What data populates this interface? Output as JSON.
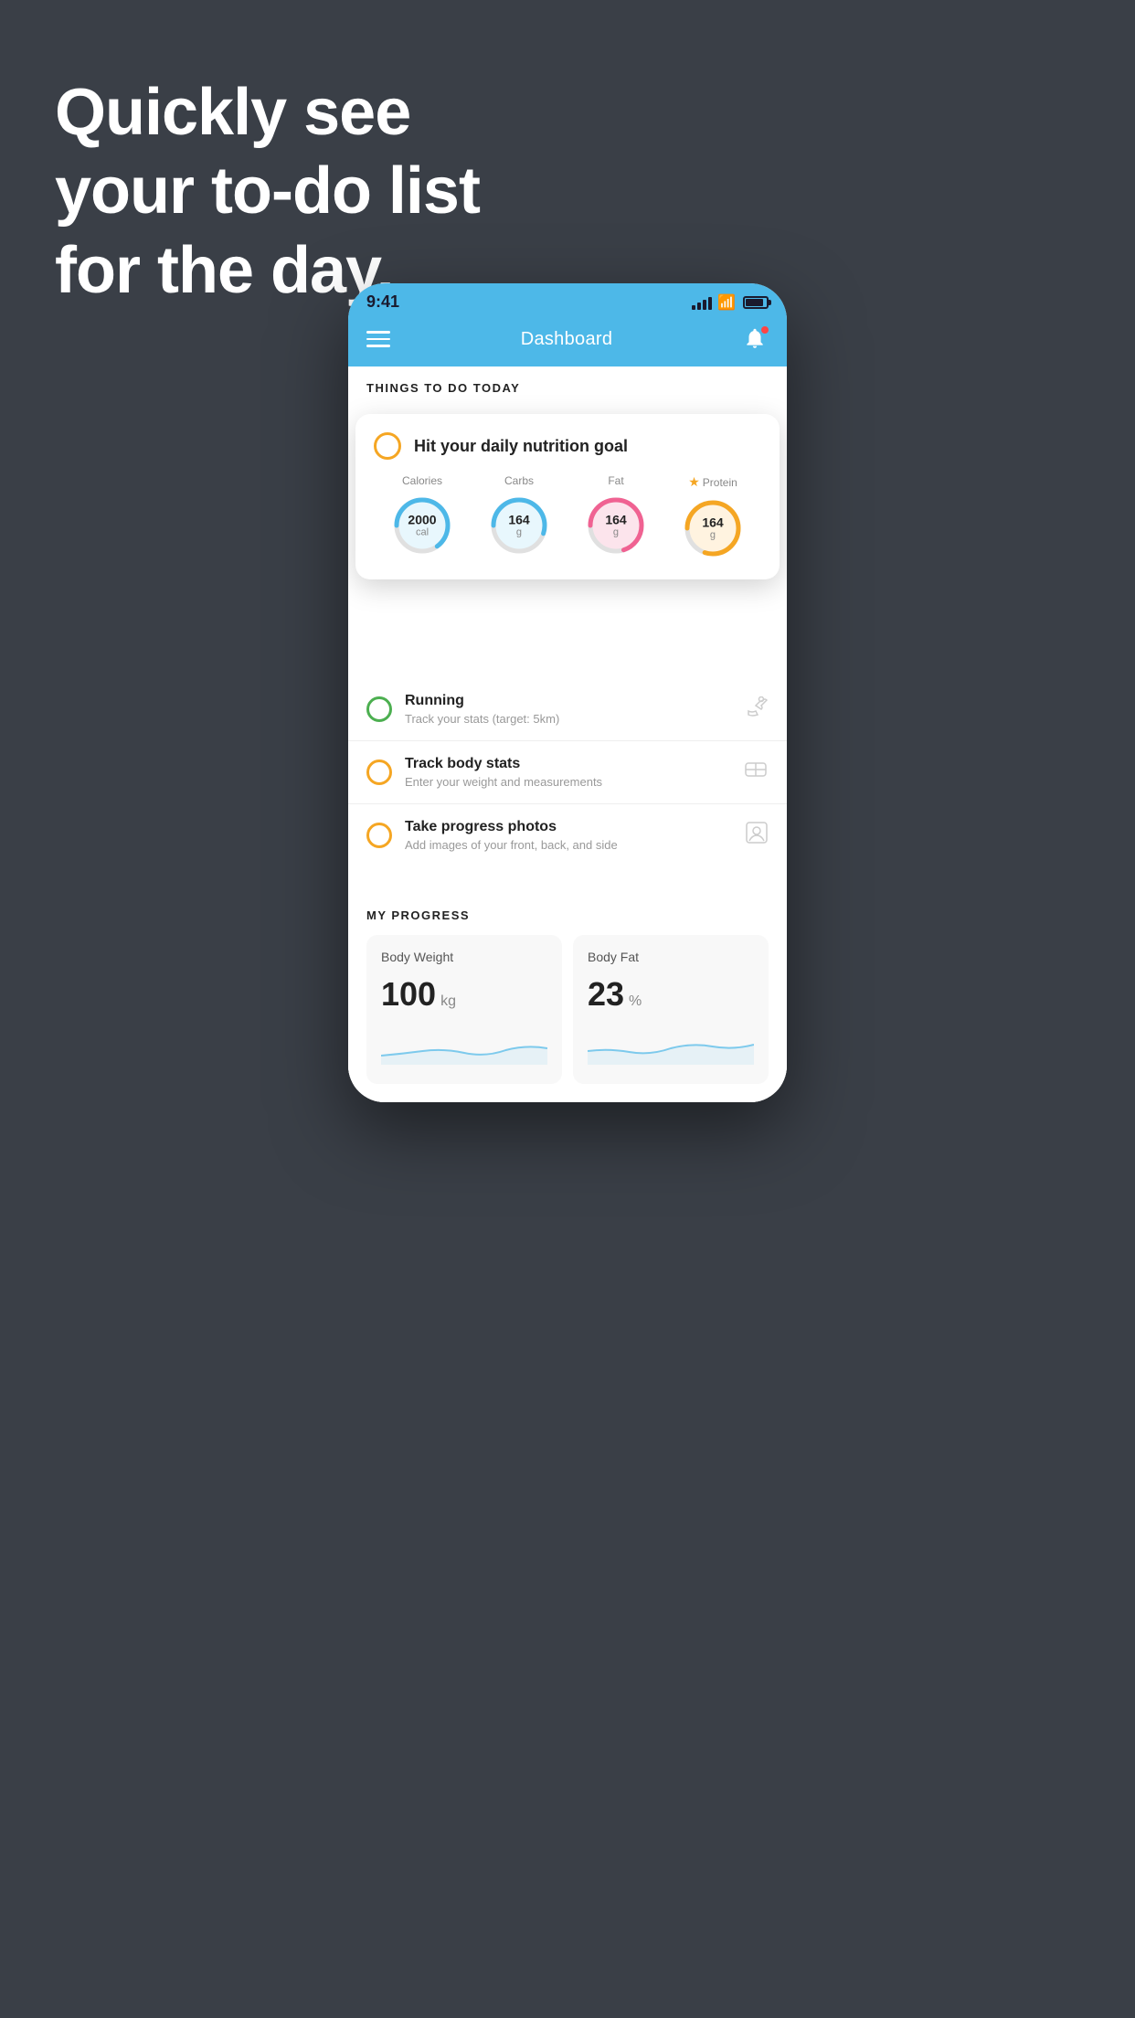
{
  "background": {
    "headline_line1": "Quickly see",
    "headline_line2": "your to-do list",
    "headline_line3": "for the day."
  },
  "status_bar": {
    "time": "9:41"
  },
  "header": {
    "title": "Dashboard"
  },
  "things_today": {
    "section_label": "THINGS TO DO TODAY",
    "floating_card": {
      "title": "Hit your daily nutrition goal",
      "nutrients": [
        {
          "label": "Calories",
          "value": "2000",
          "unit": "cal",
          "color": "#4db8e8",
          "bg_color": "#e8f7fd",
          "percent": 65,
          "starred": false
        },
        {
          "label": "Carbs",
          "value": "164",
          "unit": "g",
          "color": "#4db8e8",
          "bg_color": "#e8f7fd",
          "percent": 55,
          "starred": false
        },
        {
          "label": "Fat",
          "value": "164",
          "unit": "g",
          "color": "#f06292",
          "bg_color": "#fce4ec",
          "percent": 70,
          "starred": false
        },
        {
          "label": "Protein",
          "value": "164",
          "unit": "g",
          "color": "#f5a623",
          "bg_color": "#fff3e0",
          "percent": 80,
          "starred": true
        }
      ]
    },
    "items": [
      {
        "title": "Running",
        "subtitle": "Track your stats (target: 5km)",
        "circle_color": "green",
        "icon": "👟"
      },
      {
        "title": "Track body stats",
        "subtitle": "Enter your weight and measurements",
        "circle_color": "yellow",
        "icon": "⚖️"
      },
      {
        "title": "Take progress photos",
        "subtitle": "Add images of your front, back, and side",
        "circle_color": "yellow",
        "icon": "👤"
      }
    ]
  },
  "my_progress": {
    "section_label": "MY PROGRESS",
    "cards": [
      {
        "title": "Body Weight",
        "value": "100",
        "unit": "kg"
      },
      {
        "title": "Body Fat",
        "value": "23",
        "unit": "%"
      }
    ]
  }
}
